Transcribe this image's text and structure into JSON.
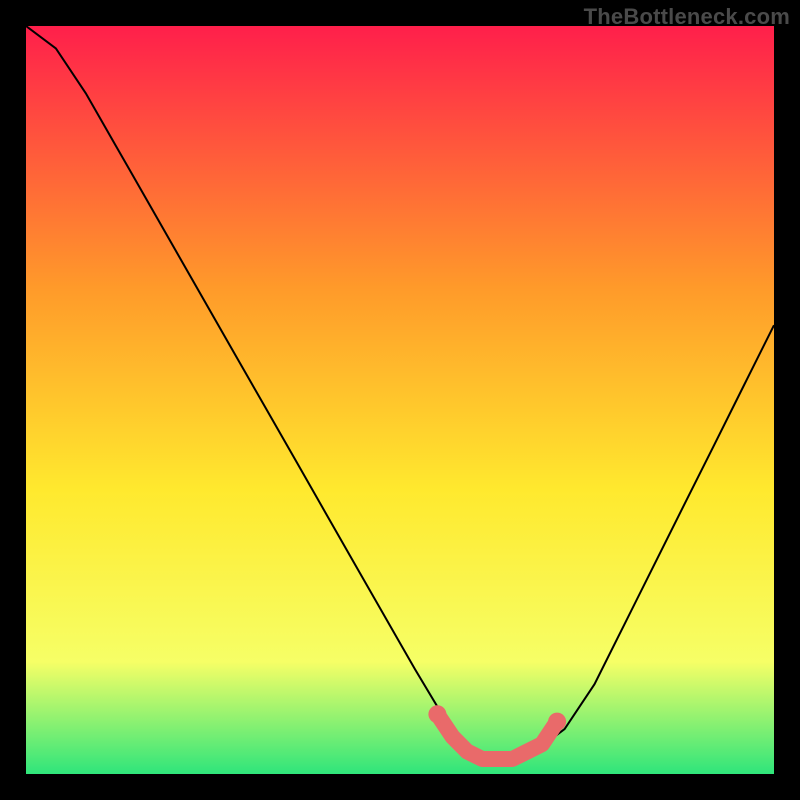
{
  "watermark": "TheBottleneck.com",
  "colors": {
    "background": "#000000",
    "gradient_top": "#ff1f4b",
    "gradient_mid1": "#ff9a2a",
    "gradient_mid2": "#ffe92e",
    "gradient_mid3": "#f6ff66",
    "gradient_bottom": "#2fe57b",
    "curve": "#000000",
    "marker": "#e96a6a"
  },
  "chart_data": {
    "type": "line",
    "title": "",
    "xlabel": "",
    "ylabel": "",
    "xlim": [
      0,
      100
    ],
    "ylim": [
      0,
      100
    ],
    "series": [
      {
        "name": "bottleneck-curve",
        "x": [
          0,
          4,
          8,
          12,
          16,
          20,
          24,
          28,
          32,
          36,
          40,
          44,
          48,
          52,
          55,
          58,
          60,
          62,
          64,
          66,
          68,
          72,
          76,
          80,
          84,
          88,
          92,
          96,
          100
        ],
        "y": [
          100,
          97,
          91,
          84,
          77,
          70,
          63,
          56,
          49,
          42,
          35,
          28,
          21,
          14,
          9,
          5,
          3,
          2,
          2,
          2,
          3,
          6,
          12,
          20,
          28,
          36,
          44,
          52,
          60
        ]
      }
    ],
    "markers": {
      "name": "optimal-range",
      "x": [
        55,
        57,
        59,
        61,
        63,
        65,
        67,
        69,
        71
      ],
      "y": [
        8,
        5,
        3,
        2,
        2,
        2,
        3,
        4,
        7
      ]
    }
  }
}
